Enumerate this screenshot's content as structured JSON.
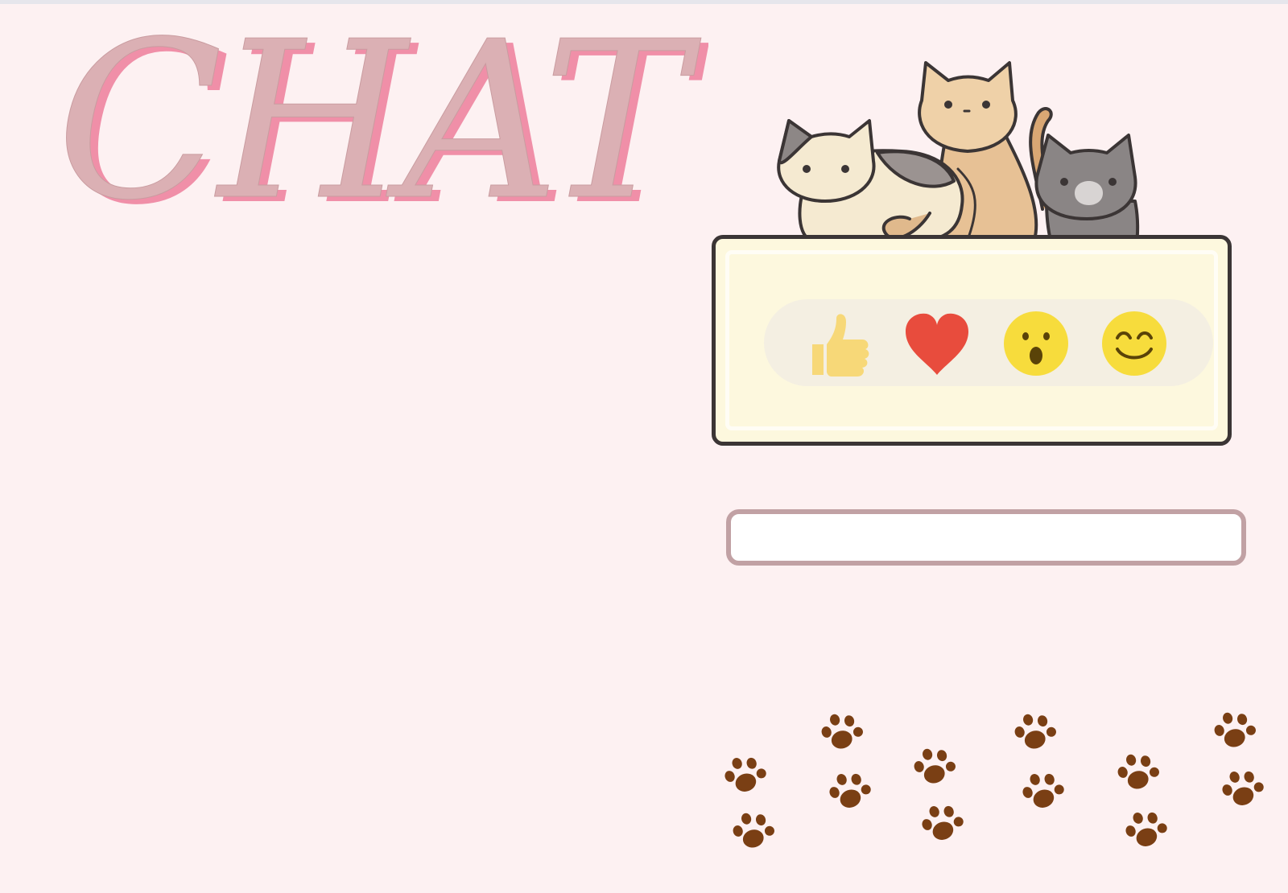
{
  "title": "CHAT",
  "colors": {
    "background": "#fdf1f2",
    "title_fill": "#dbb0b4",
    "title_shadow": "#f08fa8",
    "card_bg": "#fdf8de",
    "card_border": "#3b3535",
    "input_border": "#c1a1a4",
    "paw": "#7a3f14"
  },
  "reactions": [
    {
      "name": "like",
      "icon": "thumbs-up-icon"
    },
    {
      "name": "love",
      "icon": "heart-icon"
    },
    {
      "name": "wow",
      "icon": "surprised-face-icon"
    },
    {
      "name": "haha",
      "icon": "smiling-face-icon"
    }
  ],
  "chat_input": {
    "value": "",
    "placeholder": ""
  },
  "decorations": {
    "cats_icon": "three-cats-illustration",
    "paw_icon": "paw-print-icon"
  }
}
